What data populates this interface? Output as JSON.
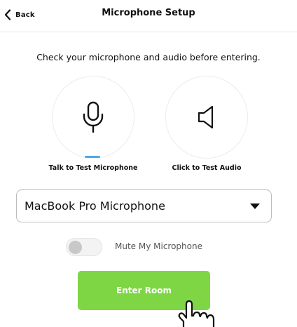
{
  "header": {
    "back_label": "Back",
    "title": "Microphone Setup"
  },
  "instruction": "Check your microphone and audio before entering.",
  "mic_test": {
    "icon": "microphone-icon",
    "label": "Talk to Test Microphone"
  },
  "audio_test": {
    "icon": "speaker-icon",
    "label": "Click to Test Audio"
  },
  "device_select": {
    "selected": "MacBook Pro Microphone"
  },
  "mute_toggle": {
    "label": "Mute My Microphone",
    "on": false
  },
  "enter_button": {
    "label": "Enter Room"
  },
  "colors": {
    "accent_green": "#7fd645",
    "mic_level_blue": "#4aa8e8"
  }
}
